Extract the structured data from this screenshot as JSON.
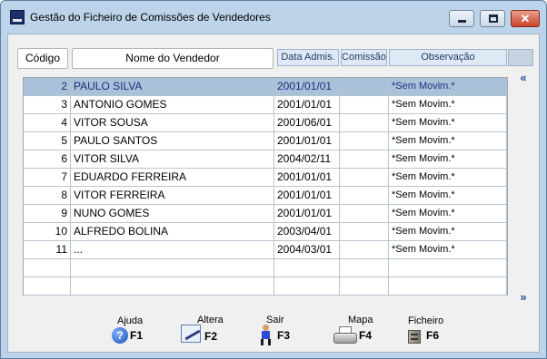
{
  "window": {
    "title": "Gestão do Ficheiro de Comissões de Vendedores",
    "controls": {
      "minimize": "minimize",
      "maximize": "maximize",
      "close": "✕"
    }
  },
  "columns": {
    "codigo": "Código",
    "nome": "Nome do Vendedor",
    "data_admis": "Data Admis.",
    "comissao": "Comissão",
    "observacao": "Observação"
  },
  "rows": [
    {
      "code": "2",
      "name": "PAULO SILVA",
      "date": "2001/01/01",
      "comissao": "",
      "obs": "*Sem Movim.*"
    },
    {
      "code": "3",
      "name": "ANTONIO GOMES",
      "date": "2001/01/01",
      "comissao": "",
      "obs": "*Sem Movim.*"
    },
    {
      "code": "4",
      "name": "VITOR SOUSA",
      "date": "2001/06/01",
      "comissao": "",
      "obs": "*Sem Movim.*"
    },
    {
      "code": "5",
      "name": "PAULO SANTOS",
      "date": "2001/01/01",
      "comissao": "",
      "obs": "*Sem Movim.*"
    },
    {
      "code": "6",
      "name": "VITOR SILVA",
      "date": "2004/02/11",
      "comissao": "",
      "obs": "*Sem Movim.*"
    },
    {
      "code": "7",
      "name": "EDUARDO FERREIRA",
      "date": "2001/01/01",
      "comissao": "",
      "obs": "*Sem Movim.*"
    },
    {
      "code": "8",
      "name": "VITOR FERREIRA",
      "date": "2001/01/01",
      "comissao": "",
      "obs": "*Sem Movim.*"
    },
    {
      "code": "9",
      "name": "NUNO GOMES",
      "date": "2001/01/01",
      "comissao": "",
      "obs": "*Sem Movim.*"
    },
    {
      "code": "10",
      "name": "ALFREDO BOLINA",
      "date": "2003/04/01",
      "comissao": "",
      "obs": "*Sem Movim.*"
    },
    {
      "code": "11",
      "name": "...",
      "date": "2004/03/01",
      "comissao": "",
      "obs": "*Sem Movim.*"
    },
    {
      "code": "",
      "name": "",
      "date": "",
      "comissao": "",
      "obs": ""
    },
    {
      "code": "",
      "name": "",
      "date": "",
      "comissao": "",
      "obs": ""
    }
  ],
  "selected_row": 0,
  "nav": {
    "up": "«",
    "down": "»"
  },
  "functions": {
    "ajuda": {
      "label": "Ajuda",
      "key": "F1",
      "icon": "help-icon",
      "glyph": "?"
    },
    "altera": {
      "label": "Altera",
      "key": "F2",
      "icon": "edit-icon"
    },
    "sair": {
      "label": "Sair",
      "key": "F3",
      "icon": "exit-icon"
    },
    "mapa": {
      "label": "Mapa",
      "key": "F4",
      "icon": "printer-icon"
    },
    "ficheiro": {
      "label": "Ficheiro",
      "key": "F6",
      "icon": "file-cabinet-icon"
    }
  },
  "colors": {
    "selected_row_bg": "#a9c1d9",
    "selected_row_text": "#1c2f80",
    "frame": "#bcd3e9"
  }
}
